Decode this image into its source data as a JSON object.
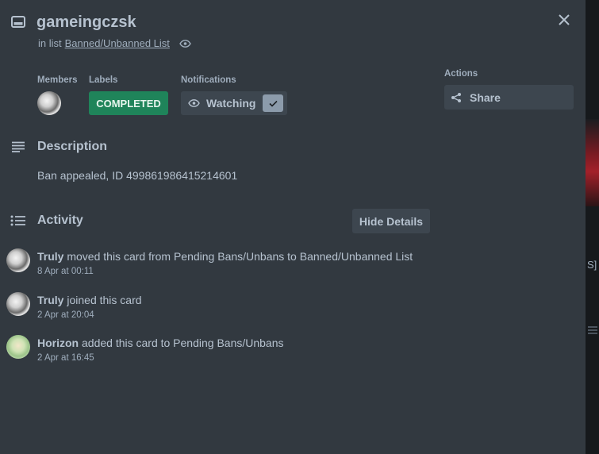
{
  "card": {
    "title": "gameingczsk",
    "in_list_prefix": "in list",
    "list_name": "Banned/Unbanned List"
  },
  "members": {
    "label": "Members",
    "avatars": [
      "Truly"
    ]
  },
  "labels": {
    "label": "Labels",
    "items": [
      {
        "text": "COMPLETED",
        "color": "#1f845a"
      }
    ]
  },
  "notifications": {
    "label": "Notifications",
    "button_text": "Watching",
    "checked": true
  },
  "actions": {
    "label": "Actions",
    "share_label": "Share"
  },
  "description": {
    "title": "Description",
    "text": "Ban appealed, ID 499861986415214601"
  },
  "activity": {
    "title": "Activity",
    "hide_details_label": "Hide Details",
    "items": [
      {
        "user": "Truly",
        "action": "moved this card from Pending Bans/Unbans to Banned/Unbanned List",
        "time": "8 Apr at 00:11"
      },
      {
        "user": "Truly",
        "action": "joined this card",
        "time": "2 Apr at 20:04"
      },
      {
        "user": "Horizon",
        "action": "added this card to Pending Bans/Unbans",
        "time": "2 Apr at 16:45"
      }
    ]
  },
  "background_fragment": {
    "text": "S]"
  }
}
